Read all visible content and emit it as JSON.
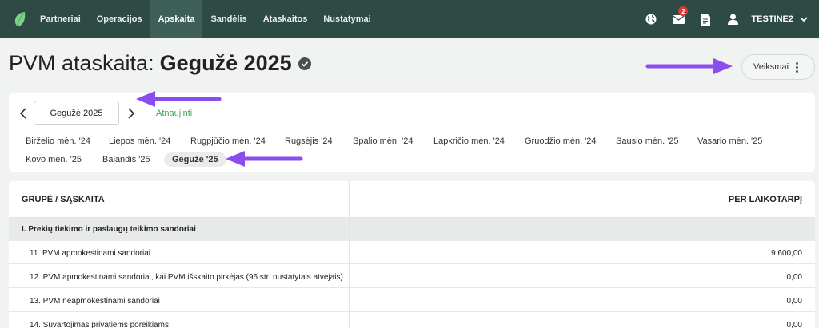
{
  "nav": {
    "items": [
      {
        "label": "Partneriai",
        "active": false
      },
      {
        "label": "Operacijos",
        "active": false
      },
      {
        "label": "Apskaita",
        "active": true
      },
      {
        "label": "Sandėlis",
        "active": false
      },
      {
        "label": "Ataskaitos",
        "active": false
      },
      {
        "label": "Nustatymai",
        "active": false
      }
    ],
    "mail_badge": "2",
    "user_name": "TESTINE2"
  },
  "title": {
    "prefix": "PVM ataskaita:",
    "period": "Gegužė 2025"
  },
  "actions_label": "Veiksmai",
  "period_selector": {
    "current": "Gegužė 2025",
    "refresh_label": "Atnaujinti"
  },
  "months_row1": [
    "Birželio mėn. '24",
    "Liepos mėn. '24",
    "Rugpjūčio mėn. '24",
    "Rugsėjis '24",
    "Spalio mėn. '24",
    "Lapkričio mėn. '24",
    "Gruodžio mėn. '24",
    "Sausio mėn. '25",
    "Vasario mėn. '25"
  ],
  "months_row2": [
    "Kovo mėn. '25",
    "Balandis '25",
    "Gegužė '25"
  ],
  "active_month": "Gegužė '25",
  "table": {
    "col_group": "GRUPĖ / SĄSKAITA",
    "col_period": "PER LAIKOTARPĮ",
    "group_title": "I. Prekių tiekimo ir paslaugų teikimo sandoriai",
    "rows": [
      {
        "label": "11. PVM apmokestinami sandoriai",
        "value": "9 600,00"
      },
      {
        "label": "12. PVM apmokestinami sandoriai, kai PVM išskaito pirkėjas (96 str. nustatytais atvejais)",
        "value": "0,00"
      },
      {
        "label": "13. PVM neapmokestinami sandoriai",
        "value": "0,00"
      },
      {
        "label": "14. Suvartojimas privatiems poreikiams",
        "value": "0,00"
      }
    ]
  },
  "colors": {
    "nav_bg": "#2e4a44",
    "nav_active": "#3e6058",
    "link_green": "#3aa35a",
    "annotation_arrow": "#8b4cf0"
  }
}
